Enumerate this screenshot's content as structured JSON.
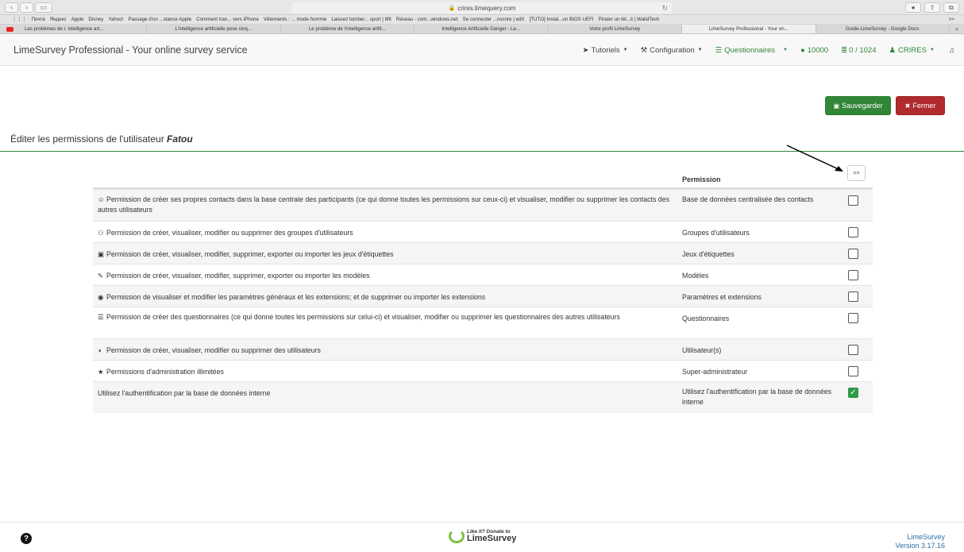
{
  "browser": {
    "url": "crires.limequery.com",
    "favorites": [
      "Почта",
      "Яндекс",
      "Apple",
      "Disney",
      "Yahoo!",
      "Passage d'un ...stance Apple",
      "Comment tran... vers iPhone",
      "Vêtements : ... mode homme",
      "Laissez tomber... sport | 8fit",
      "Réseau - com...windows.net",
      "Se connecter ...nscrire | edX",
      "[TUTO] Instal...un BIOS UEFI",
      "Pirater un tél...it | WalidTech"
    ],
    "favorites_more": ">>",
    "tabs": [
      "Les probèmes de l. intelligence art...",
      "L'intelligence artificielle pose cinq...",
      "Le problème de l'intelligence artifi...",
      "Intelligence Artificielle Danger - Le...",
      "Votre profil LimeSurvey",
      "LimeSurvey Professional - Your on...",
      "Guide-LimeSurvey - Google Docs"
    ],
    "tab_new": "+"
  },
  "navbar": {
    "brand": "LimeSurvey Professional - Your online survey service",
    "tutorials": "Tutoriels",
    "configuration": "Configuration",
    "surveys": "Questionnaires",
    "responses": "10000",
    "storage": "0 / 1024",
    "user": "CRIRES"
  },
  "actions": {
    "save": "Sauvegarder",
    "close": "Fermer"
  },
  "page": {
    "title_prefix": "Éditer les permissions de l'utilisateur ",
    "username": "Fatou"
  },
  "table": {
    "permission_header": "Permission",
    "expand_label": ">>",
    "rows": [
      {
        "icon": "participants-icon",
        "glyph": "☺",
        "desc": "Permission de créer ses propres contacts dans la base centrale des participants (ce qui donne toutes les permissions sur ceux-ci) et visualiser, modifier ou supprimer les contacts des autres utilisateurs",
        "perm": "Base de données centralisée des contacts",
        "checked": false
      },
      {
        "icon": "user-groups-icon",
        "glyph": "⚇",
        "desc": "Permission de créer, visualiser, modifier ou supprimer des groupes d'utilisateurs",
        "perm": "Groupes d'utilisateurs",
        "checked": false
      },
      {
        "icon": "label-sets-icon",
        "glyph": "▣",
        "desc": "Permission de créer, visualiser, modifier, supprimer, exporter ou importer les jeux d'étiquettes",
        "perm": "Jeux d'étiquettes",
        "checked": false
      },
      {
        "icon": "brush-icon",
        "glyph": "✎",
        "desc": "Permission de créer, visualiser, modifier, supprimer, exporter ou importer les modèles",
        "perm": "Modèles",
        "checked": false
      },
      {
        "icon": "globe-icon",
        "glyph": "◉",
        "desc": "Permission de visualiser et modifier les paramètres généraux et les extensions; et de supprimer ou importer les extensions",
        "perm": "Paramètres et extensions",
        "checked": false
      },
      {
        "icon": "list-icon",
        "glyph": "☰",
        "desc": "Permission de créer des questionnaires (ce qui donne toutes les permissions sur celui-ci) et visualiser, modifier ou supprimer les questionnaires des autres utilisateurs",
        "perm": "Questionnaires",
        "checked": false
      },
      {
        "icon": "shield-icon",
        "glyph": "◖",
        "desc": "Permission de créer, visualiser, modifier ou supprimer des utilisateurs",
        "perm": "Utilisateur(s)",
        "checked": false
      },
      {
        "icon": "star-icon",
        "glyph": "★",
        "desc": "Permissions d'administration illimitées",
        "perm": "Super-administrateur",
        "checked": false
      },
      {
        "icon": "",
        "glyph": "",
        "desc": "Utilisez l'authentification par la base de données interne",
        "perm": "Utilisez l'authentification par la base de données interne",
        "checked": true
      }
    ]
  },
  "footer": {
    "donate_small": "Like it? Donate to",
    "donate_big": "LimeSurvey",
    "product": "LimeSurvey",
    "version": "Version 3.17.16"
  },
  "colors": {
    "brand_green": "#328637",
    "danger_red": "#b02a2e"
  }
}
